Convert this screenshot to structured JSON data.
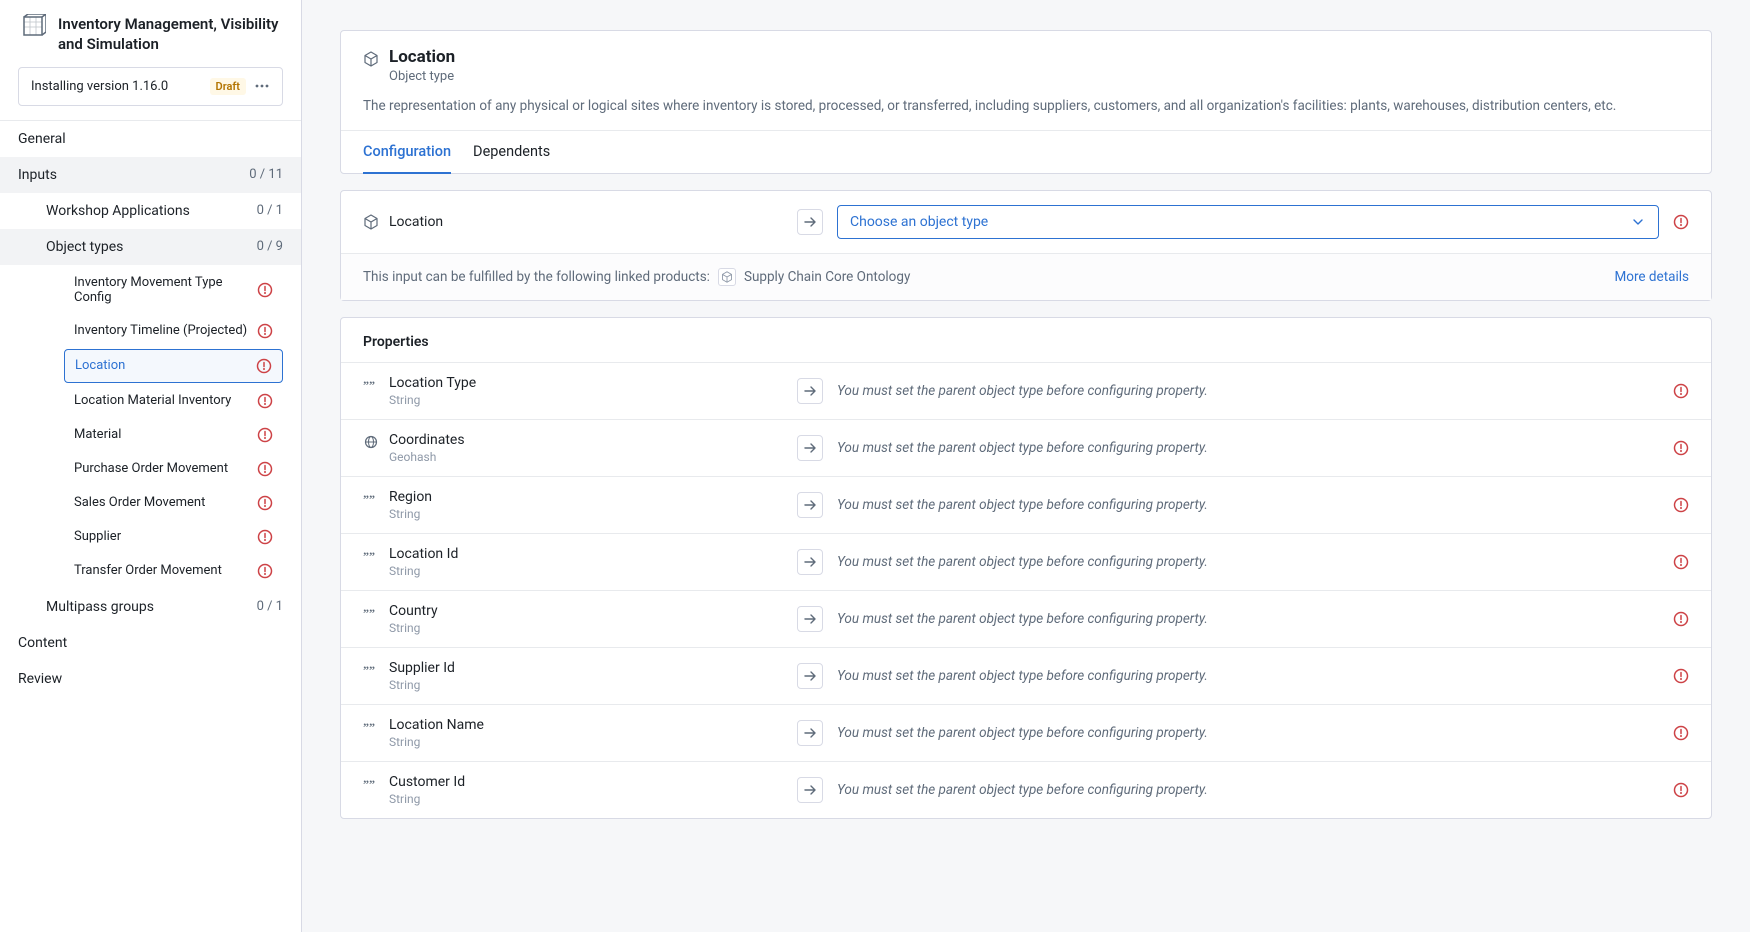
{
  "sidebar": {
    "title": "Inventory Management, Visibility and Simulation",
    "version_text": "Installing version 1.16.0",
    "draft_badge": "Draft",
    "nav": {
      "general": "General",
      "inputs": {
        "label": "Inputs",
        "count": "0 / 11"
      },
      "workshop": {
        "label": "Workshop Applications",
        "count": "0 / 1"
      },
      "object_types": {
        "label": "Object types",
        "count": "0 / 9"
      },
      "multipass": {
        "label": "Multipass groups",
        "count": "0 / 1"
      },
      "content": "Content",
      "review": "Review"
    },
    "object_type_items": [
      "Inventory Movement Type Config",
      "Inventory Timeline (Projected)",
      "Location",
      "Location Material Inventory",
      "Material",
      "Purchase Order Movement",
      "Sales Order Movement",
      "Supplier",
      "Transfer Order Movement"
    ],
    "active_index": 2
  },
  "main": {
    "header": {
      "title": "Location",
      "subtitle": "Object type",
      "description": "The representation of any physical or logical sites where inventory is stored, processed, or transferred, including suppliers, customers, and all organization's facilities: plants, warehouses, distribution centers, etc."
    },
    "tabs": [
      {
        "label": "Configuration",
        "active": true
      },
      {
        "label": "Dependents",
        "active": false
      }
    ],
    "mapping": {
      "source_label": "Location",
      "select_placeholder": "Choose an object type"
    },
    "linked": {
      "text": "This input can be fulfilled by the following linked products:",
      "product": "Supply Chain Core Ontology",
      "more": "More details"
    },
    "properties_header": "Properties",
    "property_msg": "You must set the parent object type before configuring property.",
    "properties": [
      {
        "name": "Location Type",
        "type": "String",
        "icon": "string"
      },
      {
        "name": "Coordinates",
        "type": "Geohash",
        "icon": "geo"
      },
      {
        "name": "Region",
        "type": "String",
        "icon": "string"
      },
      {
        "name": "Location Id",
        "type": "String",
        "icon": "string"
      },
      {
        "name": "Country",
        "type": "String",
        "icon": "string"
      },
      {
        "name": "Supplier Id",
        "type": "String",
        "icon": "string"
      },
      {
        "name": "Location Name",
        "type": "String",
        "icon": "string"
      },
      {
        "name": "Customer Id",
        "type": "String",
        "icon": "string"
      }
    ]
  }
}
